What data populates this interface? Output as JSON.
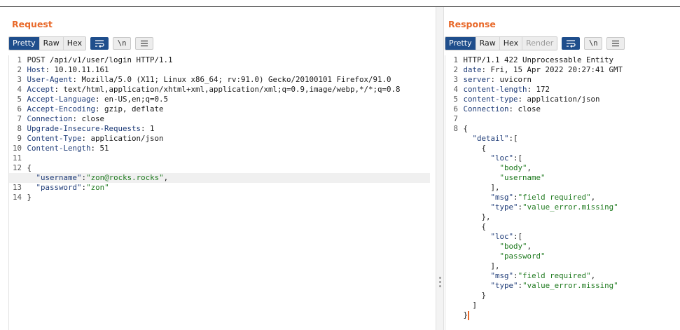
{
  "colors": {
    "accent": "#e8692a",
    "active_tab": "#1f4e8c",
    "key": "#1f3c78",
    "string": "#1f7a1f"
  },
  "request": {
    "title": "Request",
    "tabs": [
      "Pretty",
      "Raw",
      "Hex"
    ],
    "active_tab": "Pretty",
    "icons": [
      "wrap-lines-icon",
      "newline-icon",
      "menu-icon"
    ],
    "newline_label": "\\n",
    "lines": [
      {
        "n": "1",
        "parts": [
          {
            "t": "POST /api/v1/user/login HTTP/1.1",
            "c": "p"
          }
        ]
      },
      {
        "n": "2",
        "parts": [
          {
            "t": "Host",
            "c": "k"
          },
          {
            "t": ": 10.10.11.161",
            "c": "p"
          }
        ]
      },
      {
        "n": "3",
        "parts": [
          {
            "t": "User-Agent",
            "c": "k"
          },
          {
            "t": ": Mozilla/5.0 (X11; Linux x86_64; rv:91.0) Gecko/20100101 Firefox/91.0",
            "c": "p"
          }
        ]
      },
      {
        "n": "4",
        "parts": [
          {
            "t": "Accept",
            "c": "k"
          },
          {
            "t": ": text/html,application/xhtml+xml,application/xml;q=0.9,image/webp,*/*;q=0.8",
            "c": "p"
          }
        ]
      },
      {
        "n": "5",
        "parts": [
          {
            "t": "Accept-Language",
            "c": "k"
          },
          {
            "t": ": en-US,en;q=0.5",
            "c": "p"
          }
        ]
      },
      {
        "n": "6",
        "parts": [
          {
            "t": "Accept-Encoding",
            "c": "k"
          },
          {
            "t": ": gzip, deflate",
            "c": "p"
          }
        ]
      },
      {
        "n": "7",
        "parts": [
          {
            "t": "Connection",
            "c": "k"
          },
          {
            "t": ": close",
            "c": "p"
          }
        ]
      },
      {
        "n": "8",
        "parts": [
          {
            "t": "Upgrade-Insecure-Requests",
            "c": "k"
          },
          {
            "t": ": 1",
            "c": "p"
          }
        ]
      },
      {
        "n": "9",
        "parts": [
          {
            "t": "Content-Type",
            "c": "k"
          },
          {
            "t": ": application/json",
            "c": "p"
          }
        ]
      },
      {
        "n": "10",
        "parts": [
          {
            "t": "Content-Length",
            "c": "k"
          },
          {
            "t": ": 51",
            "c": "p"
          }
        ]
      },
      {
        "n": "11",
        "parts": []
      },
      {
        "n": "12",
        "parts": [
          {
            "t": "{",
            "c": "p"
          }
        ]
      },
      {
        "n": "",
        "hl": true,
        "parts": [
          {
            "t": "  ",
            "c": "p"
          },
          {
            "t": "\"username\"",
            "c": "k"
          },
          {
            "t": ":",
            "c": "p"
          },
          {
            "t": "\"zon@rocks.rocks\"",
            "c": "s"
          },
          {
            "t": ",",
            "c": "p"
          }
        ]
      },
      {
        "n": "13",
        "parts": [
          {
            "t": "  ",
            "c": "p"
          },
          {
            "t": "\"password\"",
            "c": "k"
          },
          {
            "t": ":",
            "c": "p"
          },
          {
            "t": "\"zon\"",
            "c": "s"
          }
        ]
      },
      {
        "n": "14",
        "parts": [
          {
            "t": "}",
            "c": "p"
          }
        ]
      }
    ]
  },
  "response": {
    "title": "Response",
    "tabs": [
      "Pretty",
      "Raw",
      "Hex",
      "Render"
    ],
    "active_tab": "Pretty",
    "disabled_tab": "Render",
    "icons": [
      "wrap-lines-icon",
      "newline-icon",
      "menu-icon"
    ],
    "newline_label": "\\n",
    "lines": [
      {
        "n": "1",
        "parts": [
          {
            "t": "HTTP/1.1 422 Unprocessable Entity",
            "c": "p"
          }
        ]
      },
      {
        "n": "2",
        "parts": [
          {
            "t": "date",
            "c": "k"
          },
          {
            "t": ": Fri, 15 Apr 2022 20:27:41 GMT",
            "c": "p"
          }
        ]
      },
      {
        "n": "3",
        "parts": [
          {
            "t": "server",
            "c": "k"
          },
          {
            "t": ": uvicorn",
            "c": "p"
          }
        ]
      },
      {
        "n": "4",
        "parts": [
          {
            "t": "content-length",
            "c": "k"
          },
          {
            "t": ": 172",
            "c": "p"
          }
        ]
      },
      {
        "n": "5",
        "parts": [
          {
            "t": "content-type",
            "c": "k"
          },
          {
            "t": ": application/json",
            "c": "p"
          }
        ]
      },
      {
        "n": "6",
        "parts": [
          {
            "t": "Connection",
            "c": "k"
          },
          {
            "t": ": close",
            "c": "p"
          }
        ]
      },
      {
        "n": "7",
        "parts": []
      },
      {
        "n": "8",
        "parts": [
          {
            "t": "{",
            "c": "p"
          }
        ]
      },
      {
        "n": "",
        "parts": [
          {
            "t": "  ",
            "c": "p"
          },
          {
            "t": "\"detail\"",
            "c": "k"
          },
          {
            "t": ":[",
            "c": "p"
          }
        ]
      },
      {
        "n": "",
        "parts": [
          {
            "t": "    {",
            "c": "p"
          }
        ]
      },
      {
        "n": "",
        "parts": [
          {
            "t": "      ",
            "c": "p"
          },
          {
            "t": "\"loc\"",
            "c": "k"
          },
          {
            "t": ":[",
            "c": "p"
          }
        ]
      },
      {
        "n": "",
        "parts": [
          {
            "t": "        ",
            "c": "p"
          },
          {
            "t": "\"body\"",
            "c": "s"
          },
          {
            "t": ",",
            "c": "p"
          }
        ]
      },
      {
        "n": "",
        "parts": [
          {
            "t": "        ",
            "c": "p"
          },
          {
            "t": "\"username\"",
            "c": "s"
          }
        ]
      },
      {
        "n": "",
        "parts": [
          {
            "t": "      ],",
            "c": "p"
          }
        ]
      },
      {
        "n": "",
        "parts": [
          {
            "t": "      ",
            "c": "p"
          },
          {
            "t": "\"msg\"",
            "c": "k"
          },
          {
            "t": ":",
            "c": "p"
          },
          {
            "t": "\"field required\"",
            "c": "s"
          },
          {
            "t": ",",
            "c": "p"
          }
        ]
      },
      {
        "n": "",
        "parts": [
          {
            "t": "      ",
            "c": "p"
          },
          {
            "t": "\"type\"",
            "c": "k"
          },
          {
            "t": ":",
            "c": "p"
          },
          {
            "t": "\"value_error.missing\"",
            "c": "s"
          }
        ]
      },
      {
        "n": "",
        "parts": [
          {
            "t": "    },",
            "c": "p"
          }
        ]
      },
      {
        "n": "",
        "parts": [
          {
            "t": "    {",
            "c": "p"
          }
        ]
      },
      {
        "n": "",
        "parts": [
          {
            "t": "      ",
            "c": "p"
          },
          {
            "t": "\"loc\"",
            "c": "k"
          },
          {
            "t": ":[",
            "c": "p"
          }
        ]
      },
      {
        "n": "",
        "parts": [
          {
            "t": "        ",
            "c": "p"
          },
          {
            "t": "\"body\"",
            "c": "s"
          },
          {
            "t": ",",
            "c": "p"
          }
        ]
      },
      {
        "n": "",
        "parts": [
          {
            "t": "        ",
            "c": "p"
          },
          {
            "t": "\"password\"",
            "c": "s"
          }
        ]
      },
      {
        "n": "",
        "parts": [
          {
            "t": "      ],",
            "c": "p"
          }
        ]
      },
      {
        "n": "",
        "parts": [
          {
            "t": "      ",
            "c": "p"
          },
          {
            "t": "\"msg\"",
            "c": "k"
          },
          {
            "t": ":",
            "c": "p"
          },
          {
            "t": "\"field required\"",
            "c": "s"
          },
          {
            "t": ",",
            "c": "p"
          }
        ]
      },
      {
        "n": "",
        "parts": [
          {
            "t": "      ",
            "c": "p"
          },
          {
            "t": "\"type\"",
            "c": "k"
          },
          {
            "t": ":",
            "c": "p"
          },
          {
            "t": "\"value_error.missing\"",
            "c": "s"
          }
        ]
      },
      {
        "n": "",
        "parts": [
          {
            "t": "    }",
            "c": "p"
          }
        ]
      },
      {
        "n": "",
        "parts": [
          {
            "t": "  ]",
            "c": "p"
          }
        ]
      },
      {
        "n": "",
        "cursor": true,
        "parts": [
          {
            "t": "}",
            "c": "p"
          }
        ]
      }
    ]
  }
}
